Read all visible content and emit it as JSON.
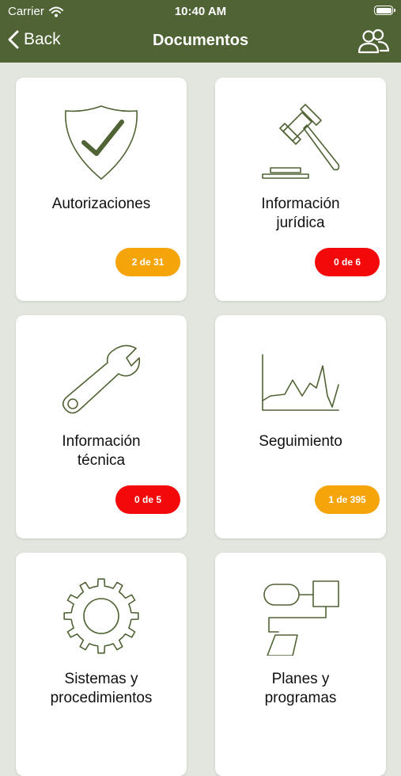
{
  "status_bar": {
    "carrier": "Carrier",
    "time": "10:40 AM"
  },
  "nav": {
    "back_label": "Back",
    "title": "Documentos"
  },
  "cards": [
    {
      "label": "Autorizaciones",
      "badge": "2 de 31",
      "badge_color": "#f5a40a",
      "icon": "shield-check-icon"
    },
    {
      "label": "Información\njurídica",
      "badge": "0 de 6",
      "badge_color": "#f4090a",
      "icon": "gavel-icon"
    },
    {
      "label": "Información\ntécnica",
      "badge": "0 de 5",
      "badge_color": "#f4090a",
      "icon": "wrench-icon"
    },
    {
      "label": "Seguimiento",
      "badge": "1 de 395",
      "badge_color": "#f5a40a",
      "icon": "line-chart-icon"
    },
    {
      "label": "Sistemas y\nprocedimientos",
      "icon": "gear-icon"
    },
    {
      "label": "Planes y\nprogramas",
      "icon": "flowchart-icon"
    }
  ],
  "colors": {
    "header": "#4f6334",
    "icon_stroke": "#4f6334",
    "background": "#e3e6df",
    "badge_orange": "#f5a40a",
    "badge_red": "#f4090a"
  }
}
